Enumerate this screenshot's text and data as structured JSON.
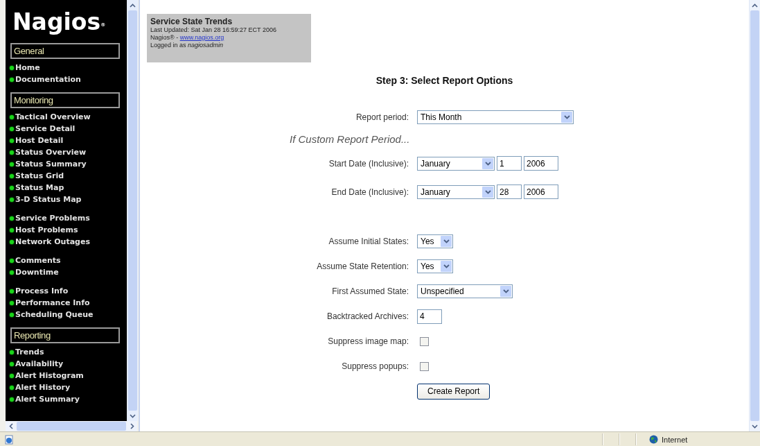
{
  "sidebar": {
    "logo": "Nagios$^{®}$",
    "sections": [
      {
        "title": "General",
        "groups": [
          [
            "Home",
            "Documentation"
          ]
        ]
      },
      {
        "title": "Monitoring",
        "groups": [
          [
            "Tactical Overview",
            "Service Detail",
            "Host Detail",
            "Status Overview",
            "Status Summary",
            "Status Grid",
            "Status Map",
            "3-D Status Map"
          ],
          [
            "Service Problems",
            "Host Problems",
            "Network Outages"
          ],
          [
            "Comments",
            "Downtime"
          ],
          [
            "Process Info",
            "Performance Info",
            "Scheduling Queue"
          ]
        ]
      },
      {
        "title": "Reporting",
        "groups": [
          [
            "Trends",
            "Availability",
            "Alert Histogram",
            "Alert History",
            "Alert Summary"
          ]
        ]
      }
    ]
  },
  "header": {
    "title": "Service State Trends",
    "updated": "Last Updated: Sat Jan 28 16:59:27 ECT 2006",
    "brand": "Nagios® - ",
    "link": "www.nagios.org",
    "login_prefix": "Logged in as ",
    "user": "nagiosadmin"
  },
  "form": {
    "title": "Step 3: Select Report Options",
    "period_rows": [
      {
        "kind": "select",
        "label": "Report period:",
        "value": "This Month"
      },
      {
        "kind": "heading",
        "text": "If Custom Report Period..."
      },
      {
        "kind": "date",
        "label": "Start Date (Inclusive):",
        "month": "January",
        "day": "1",
        "year": "2006"
      },
      {
        "kind": "date",
        "label": "End Date (Inclusive):",
        "month": "January",
        "day": "28",
        "year": "2006"
      }
    ],
    "option_rows": [
      {
        "kind": "select",
        "label": "Assume Initial States:",
        "value": "Yes"
      },
      {
        "kind": "select",
        "label": "Assume State Retention:",
        "value": "Yes"
      },
      {
        "kind": "select",
        "label": "First Assumed State:",
        "value": "Unspecified"
      },
      {
        "kind": "input",
        "label": "Backtracked Archives:",
        "value": "4"
      },
      {
        "kind": "checkbox",
        "label": "Suppress image map:",
        "checked": false
      },
      {
        "kind": "checkbox",
        "label": "Suppress popups:",
        "checked": false
      },
      {
        "kind": "button",
        "text": "Create Report"
      }
    ]
  },
  "status_bar": {
    "zone": "Internet"
  }
}
